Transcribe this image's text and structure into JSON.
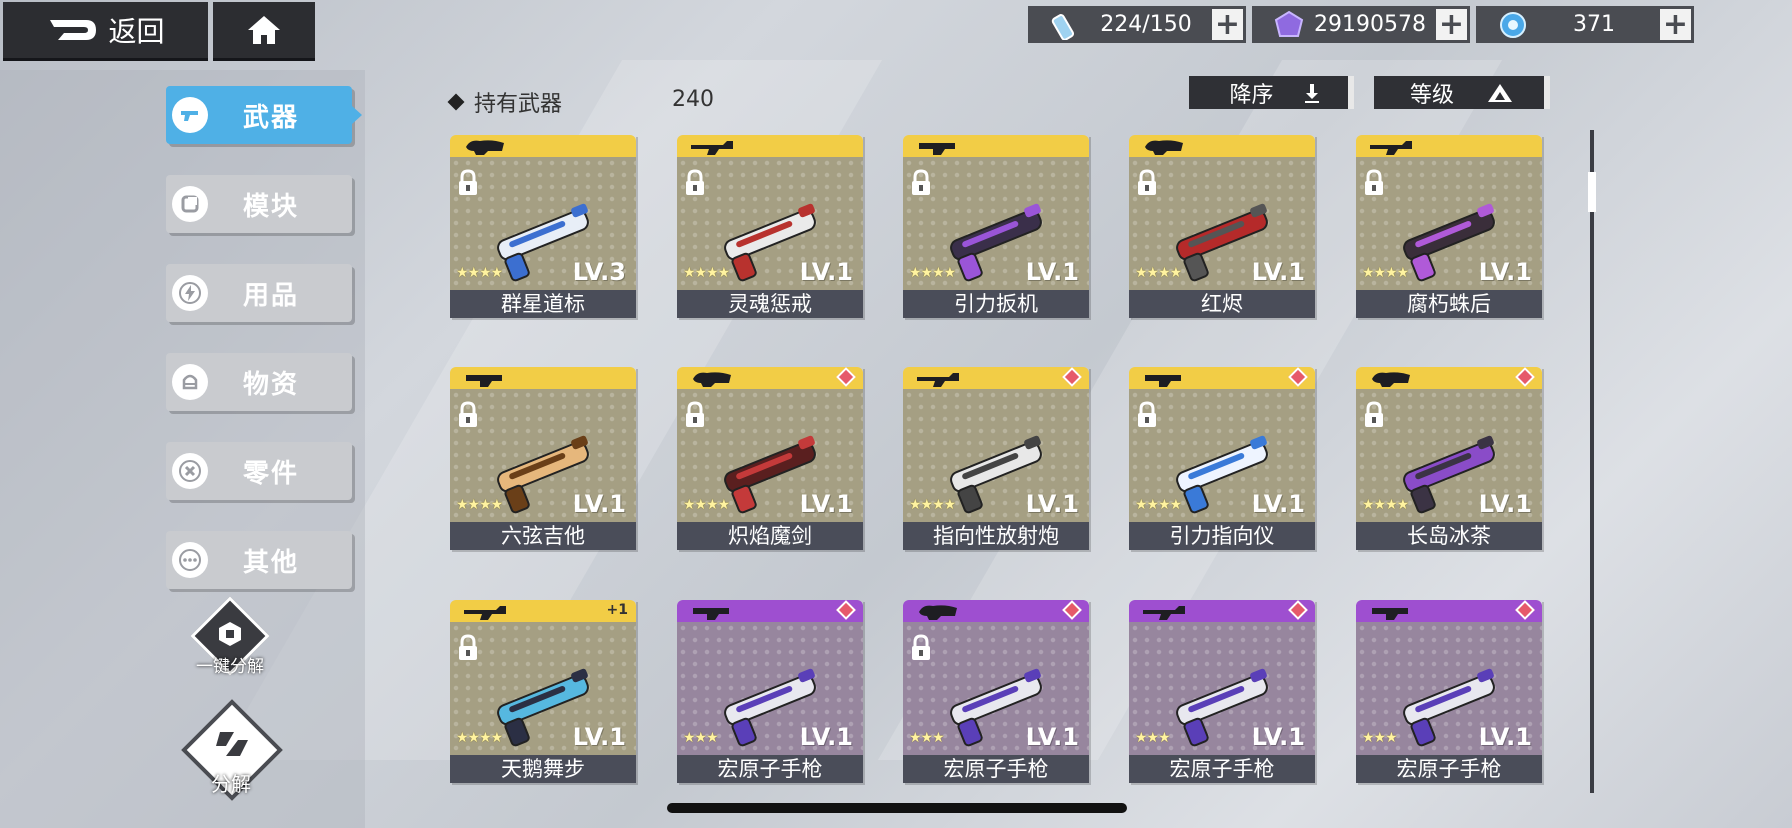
{
  "topbar": {
    "back_label": "返回",
    "resources": [
      {
        "icon": "energy-tube-icon",
        "value": "224/150"
      },
      {
        "icon": "purple-crystal-icon",
        "value": "29190578"
      },
      {
        "icon": "blue-orb-icon",
        "value": "371"
      }
    ]
  },
  "sidebar": {
    "tabs": [
      {
        "label": "武器",
        "icon": "gun-icon",
        "active": true
      },
      {
        "label": "模块",
        "icon": "module-icon",
        "active": false
      },
      {
        "label": "用品",
        "icon": "lightning-icon",
        "active": false
      },
      {
        "label": "物资",
        "icon": "supply-icon",
        "active": false
      },
      {
        "label": "零件",
        "icon": "wrench-icon",
        "active": false
      },
      {
        "label": "其他",
        "icon": "more-icon",
        "active": false
      }
    ],
    "one_key_decompose_label": "一键分解",
    "decompose_label": "分解"
  },
  "header": {
    "owned_label": "持有武器",
    "owned_count": "240",
    "sort_order_label": "降序",
    "sort_key_label": "等级"
  },
  "weapons": [
    {
      "name": "群星道标",
      "level": "LV.3",
      "stars": "★★★★",
      "rarity": "gold",
      "locked": true,
      "gem": false,
      "plus": ""
    },
    {
      "name": "灵魂惩戒",
      "level": "LV.1",
      "stars": "★★★★",
      "rarity": "gold",
      "locked": true,
      "gem": false,
      "plus": ""
    },
    {
      "name": "引力扳机",
      "level": "LV.1",
      "stars": "★★★★",
      "rarity": "gold",
      "locked": true,
      "gem": false,
      "plus": ""
    },
    {
      "name": "红烬",
      "level": "LV.1",
      "stars": "★★★★",
      "rarity": "gold",
      "locked": true,
      "gem": false,
      "plus": ""
    },
    {
      "name": "腐朽蛛后",
      "level": "LV.1",
      "stars": "★★★★",
      "rarity": "gold",
      "locked": true,
      "gem": false,
      "plus": ""
    },
    {
      "name": "六弦吉他",
      "level": "LV.1",
      "stars": "★★★★",
      "rarity": "gold",
      "locked": true,
      "gem": false,
      "plus": ""
    },
    {
      "name": "炽焰魔剑",
      "level": "LV.1",
      "stars": "★★★★",
      "rarity": "gold",
      "locked": true,
      "gem": true,
      "plus": ""
    },
    {
      "name": "指向性放射炮",
      "level": "LV.1",
      "stars": "★★★★",
      "rarity": "gold",
      "locked": false,
      "gem": true,
      "plus": ""
    },
    {
      "name": "引力指向仪",
      "level": "LV.1",
      "stars": "★★★★",
      "rarity": "gold",
      "locked": true,
      "gem": true,
      "plus": ""
    },
    {
      "name": "长岛冰茶",
      "level": "LV.1",
      "stars": "★★★★",
      "rarity": "gold",
      "locked": true,
      "gem": true,
      "plus": ""
    },
    {
      "name": "天鹅舞步",
      "level": "LV.1",
      "stars": "★★★★",
      "rarity": "gold",
      "locked": true,
      "gem": false,
      "plus": "+1"
    },
    {
      "name": "宏原子手枪",
      "level": "LV.1",
      "stars": "★★★",
      "rarity": "purple",
      "locked": false,
      "gem": true,
      "plus": ""
    },
    {
      "name": "宏原子手枪",
      "level": "LV.1",
      "stars": "★★★",
      "rarity": "purple",
      "locked": true,
      "gem": true,
      "plus": ""
    },
    {
      "name": "宏原子手枪",
      "level": "LV.1",
      "stars": "★★★",
      "rarity": "purple",
      "locked": false,
      "gem": true,
      "plus": ""
    },
    {
      "name": "宏原子手枪",
      "level": "LV.1",
      "stars": "★★★",
      "rarity": "purple",
      "locked": false,
      "gem": true,
      "plus": ""
    }
  ],
  "colors": {
    "accent_blue": "#4fb0e6",
    "gold_rarity": "#f2cd46",
    "purple_rarity": "#9e4fd0",
    "gem_red": "#e65a6a"
  }
}
